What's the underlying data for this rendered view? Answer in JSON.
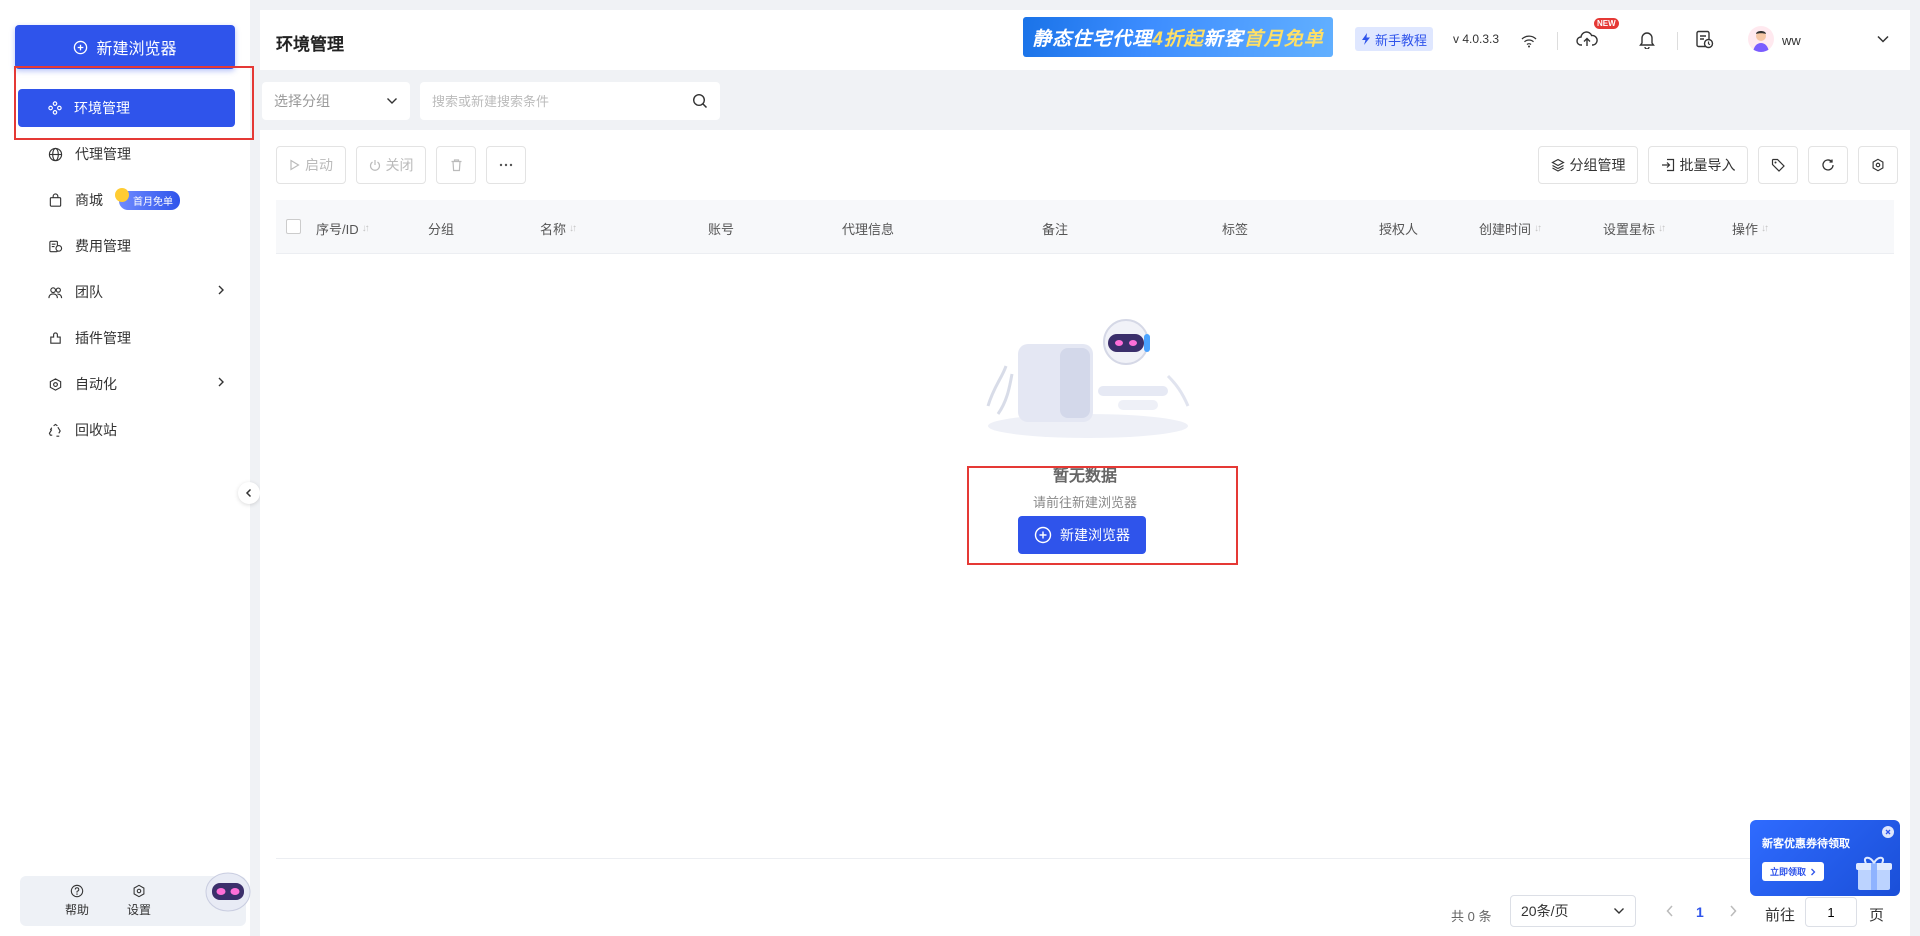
{
  "sidebar": {
    "new_browser": "新建浏览器",
    "items": [
      {
        "label": "环境管理",
        "icon": "cluster-icon",
        "active": true
      },
      {
        "label": "代理管理",
        "icon": "globe-icon"
      },
      {
        "label": "商城",
        "icon": "shopping-bag-icon",
        "badge": "首月免单"
      },
      {
        "label": "费用管理",
        "icon": "billing-icon"
      },
      {
        "label": "团队",
        "icon": "team-icon",
        "has_children": true
      },
      {
        "label": "插件管理",
        "icon": "plugin-icon"
      },
      {
        "label": "自动化",
        "icon": "automation-icon",
        "has_children": true
      },
      {
        "label": "回收站",
        "icon": "recycle-icon"
      }
    ],
    "bottom": {
      "help": "帮助",
      "settings": "设置"
    }
  },
  "header": {
    "title": "环境管理",
    "banner_text_1": "静态住宅代理",
    "banner_highlight_1": "4折起",
    "banner_text_2": " 新客",
    "banner_highlight_2": "首月免单",
    "tutorial": "新手教程",
    "version": "v 4.0.3.3",
    "new_tag": "NEW",
    "username": "ww"
  },
  "filter": {
    "group_placeholder": "选择分组",
    "search_placeholder": "搜索或新建搜索条件"
  },
  "toolbar": {
    "start": "启动",
    "close": "关闭",
    "group_manage": "分组管理",
    "batch_import": "批量导入"
  },
  "table": {
    "columns": [
      "序号/ID",
      "分组",
      "名称",
      "账号",
      "代理信息",
      "备注",
      "标签",
      "授权人",
      "创建时间",
      "设置星标",
      "操作"
    ]
  },
  "empty": {
    "title": "暂无数据",
    "subtitle": "请前往新建浏览器",
    "button": "新建浏览器"
  },
  "pagination": {
    "total": "共 0 条",
    "per_page": "20条/页",
    "current_page": "1",
    "goto_label": "前往",
    "goto_value": "1",
    "page_label": "页"
  },
  "promo": {
    "title": "新客优惠券待领取",
    "button": "立即领取"
  },
  "colors": {
    "primary": "#2f54eb",
    "highlight_box": "#e53935"
  }
}
